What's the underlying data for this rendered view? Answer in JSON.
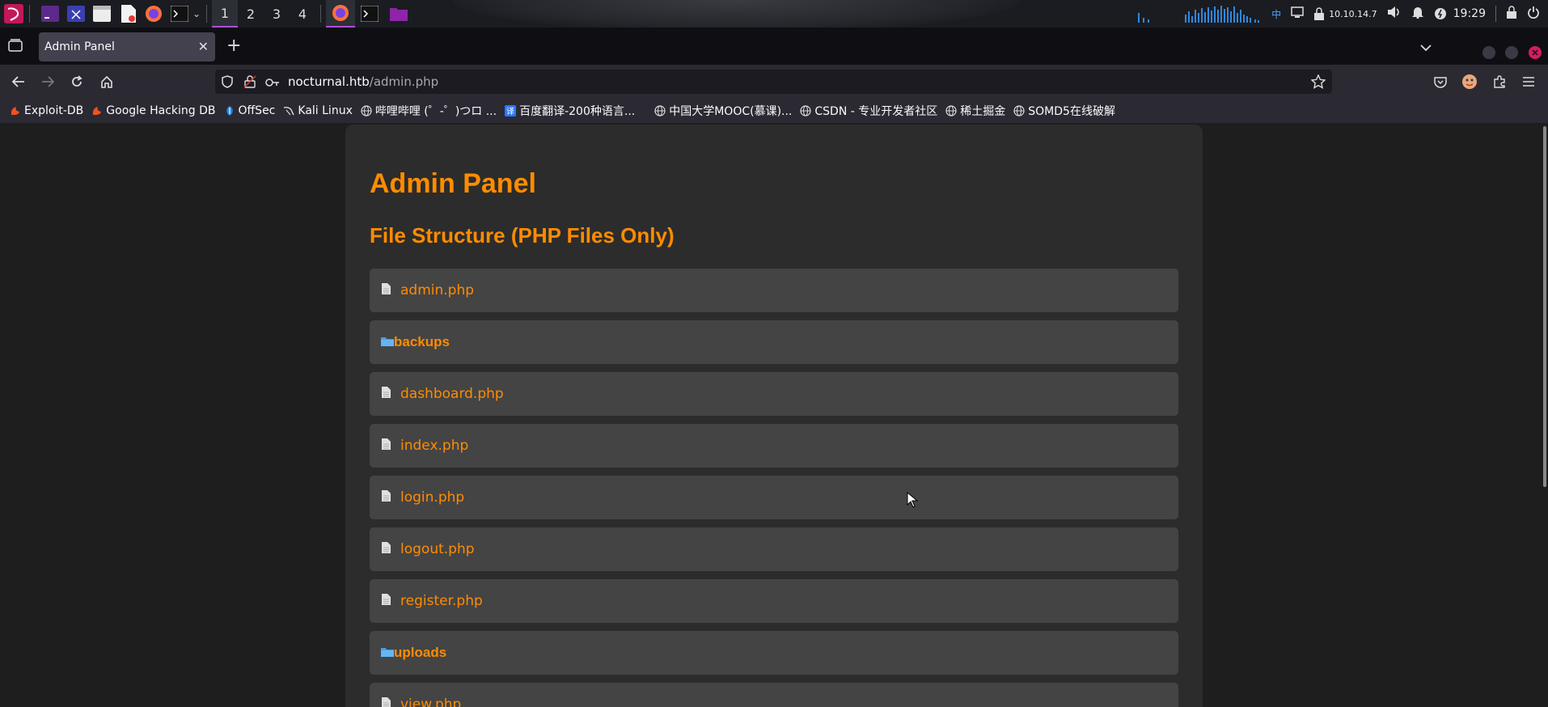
{
  "taskbar": {
    "workspaces": [
      "1",
      "2",
      "3",
      "4"
    ],
    "tray": {
      "ime": "中",
      "ip": "10.10.14.7",
      "clock": "19:29"
    }
  },
  "browser": {
    "tab": {
      "title": "Admin Panel"
    },
    "url": {
      "host": "nocturnal.htb",
      "path": "/admin.php"
    },
    "bookmarks": [
      {
        "label": "Exploit-DB",
        "icon": "exploitdb-icon"
      },
      {
        "label": "Google Hacking DB",
        "icon": "ghdb-icon"
      },
      {
        "label": "OffSec",
        "icon": "offsec-icon"
      },
      {
        "label": "Kali Linux",
        "icon": "kali-icon"
      },
      {
        "label": "哔哩哔哩 (゜-゜)つロ ...",
        "icon": "globe-icon"
      },
      {
        "label": "百度翻译-200种语言...",
        "icon": "translate-icon"
      },
      {
        "label": "中国大学MOOC(慕课)...",
        "icon": "globe-icon"
      },
      {
        "label": "CSDN - 专业开发者社区",
        "icon": "globe-icon"
      },
      {
        "label": "稀土掘金",
        "icon": "globe-icon"
      },
      {
        "label": "SOMD5在线破解",
        "icon": "globe-icon"
      }
    ]
  },
  "page": {
    "title": "Admin Panel",
    "subtitle": "File Structure (PHP Files Only)",
    "items": [
      {
        "type": "file",
        "name": "admin.php"
      },
      {
        "type": "dir",
        "name": "backups"
      },
      {
        "type": "file",
        "name": "dashboard.php"
      },
      {
        "type": "file",
        "name": "index.php"
      },
      {
        "type": "file",
        "name": "login.php"
      },
      {
        "type": "file",
        "name": "logout.php"
      },
      {
        "type": "file",
        "name": "register.php"
      },
      {
        "type": "dir",
        "name": "uploads"
      },
      {
        "type": "file",
        "name": "view.php"
      }
    ]
  },
  "colors": {
    "accent": "#ff8c00",
    "panel": "#2c2c2c",
    "item": "#444444",
    "page_bg": "#1e1e1e"
  }
}
